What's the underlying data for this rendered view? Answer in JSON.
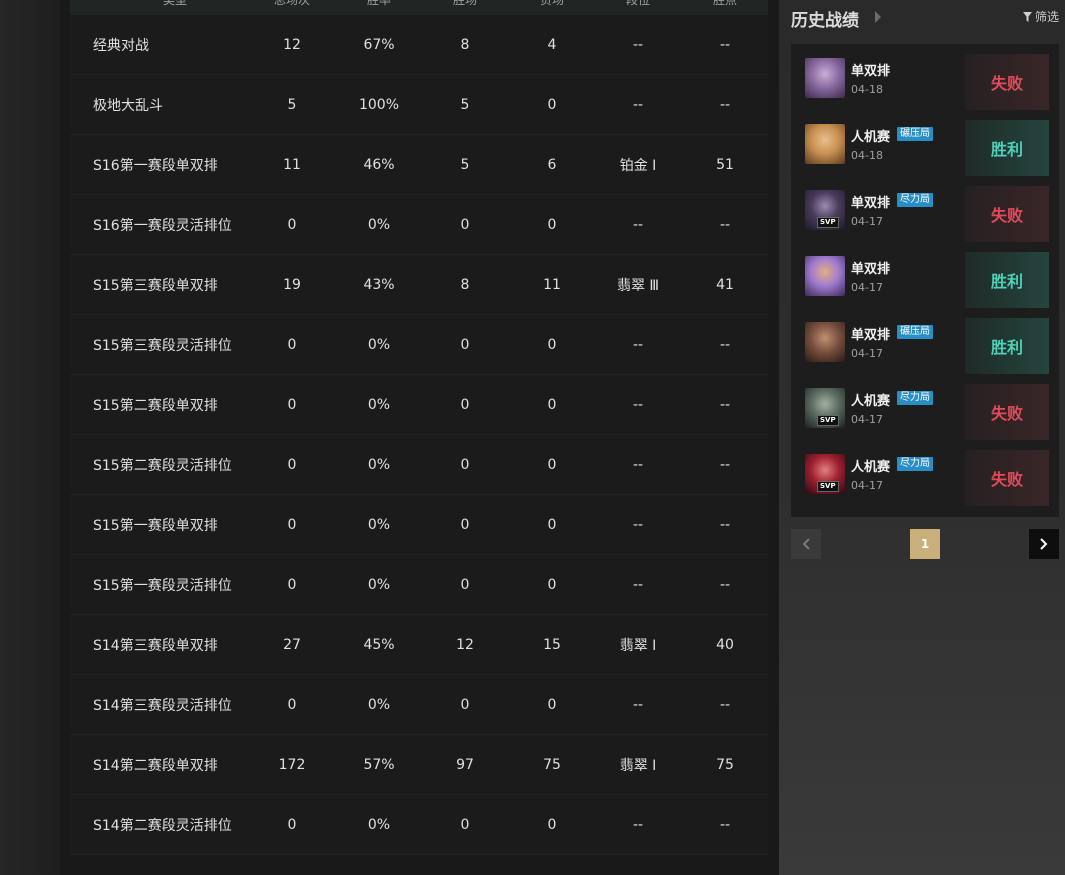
{
  "stats": {
    "headers": [
      "类型",
      "总场次",
      "胜率",
      "胜场",
      "负场",
      "段位",
      "胜点"
    ],
    "rows": [
      {
        "mode": "经典对战",
        "total": "12",
        "winrate": "67%",
        "wins": "8",
        "losses": "4",
        "rank": "--",
        "lp": "--"
      },
      {
        "mode": "极地大乱斗",
        "total": "5",
        "winrate": "100%",
        "wins": "5",
        "losses": "0",
        "rank": "--",
        "lp": "--"
      },
      {
        "mode": "S16第一赛段单双排",
        "total": "11",
        "winrate": "46%",
        "wins": "5",
        "losses": "6",
        "rank": "铂金 Ⅰ",
        "lp": "51"
      },
      {
        "mode": "S16第一赛段灵活排位",
        "total": "0",
        "winrate": "0%",
        "wins": "0",
        "losses": "0",
        "rank": "--",
        "lp": "--"
      },
      {
        "mode": "S15第三赛段单双排",
        "total": "19",
        "winrate": "43%",
        "wins": "8",
        "losses": "11",
        "rank": "翡翠 Ⅲ",
        "lp": "41"
      },
      {
        "mode": "S15第三赛段灵活排位",
        "total": "0",
        "winrate": "0%",
        "wins": "0",
        "losses": "0",
        "rank": "--",
        "lp": "--"
      },
      {
        "mode": "S15第二赛段单双排",
        "total": "0",
        "winrate": "0%",
        "wins": "0",
        "losses": "0",
        "rank": "--",
        "lp": "--"
      },
      {
        "mode": "S15第二赛段灵活排位",
        "total": "0",
        "winrate": "0%",
        "wins": "0",
        "losses": "0",
        "rank": "--",
        "lp": "--"
      },
      {
        "mode": "S15第一赛段单双排",
        "total": "0",
        "winrate": "0%",
        "wins": "0",
        "losses": "0",
        "rank": "--",
        "lp": "--"
      },
      {
        "mode": "S15第一赛段灵活排位",
        "total": "0",
        "winrate": "0%",
        "wins": "0",
        "losses": "0",
        "rank": "--",
        "lp": "--"
      },
      {
        "mode": "S14第三赛段单双排",
        "total": "27",
        "winrate": "45%",
        "wins": "12",
        "losses": "15",
        "rank": "翡翠 Ⅰ",
        "lp": "40"
      },
      {
        "mode": "S14第三赛段灵活排位",
        "total": "0",
        "winrate": "0%",
        "wins": "0",
        "losses": "0",
        "rank": "--",
        "lp": "--"
      },
      {
        "mode": "S14第二赛段单双排",
        "total": "172",
        "winrate": "57%",
        "wins": "97",
        "losses": "75",
        "rank": "翡翠 Ⅰ",
        "lp": "75"
      },
      {
        "mode": "S14第二赛段灵活排位",
        "total": "0",
        "winrate": "0%",
        "wins": "0",
        "losses": "0",
        "rank": "--",
        "lp": "--"
      }
    ]
  },
  "history": {
    "title": "历史战绩",
    "filter_label": "筛选",
    "filter_icon": "funnel-icon",
    "matches": [
      {
        "mode": "单双排",
        "tag": "",
        "date": "04-18",
        "result": "失败",
        "win": false,
        "svp": "",
        "avatar_colors": [
          "#3a2a4a",
          "#8a6aa0",
          "#c6b0d8"
        ]
      },
      {
        "mode": "人机赛",
        "tag": "碾压局",
        "date": "04-18",
        "result": "胜利",
        "win": true,
        "svp": "",
        "avatar_colors": [
          "#5a3a20",
          "#c89050",
          "#e8c090"
        ]
      },
      {
        "mode": "单双排",
        "tag": "尽力局",
        "date": "04-17",
        "result": "失败",
        "win": false,
        "svp": "SVP",
        "avatar_colors": [
          "#1a1a2a",
          "#4a3a5a",
          "#9a8ab0"
        ]
      },
      {
        "mode": "单双排",
        "tag": "",
        "date": "04-17",
        "result": "胜利",
        "win": true,
        "svp": "",
        "avatar_colors": [
          "#3a2a5a",
          "#a07ad0",
          "#e0b080"
        ]
      },
      {
        "mode": "单双排",
        "tag": "碾压局",
        "date": "04-17",
        "result": "胜利",
        "win": true,
        "svp": "",
        "avatar_colors": [
          "#2a1a14",
          "#7a5040",
          "#c09070"
        ]
      },
      {
        "mode": "人机赛",
        "tag": "尽力局",
        "date": "04-17",
        "result": "失败",
        "win": false,
        "svp": "SVP",
        "avatar_colors": [
          "#1a2020",
          "#5a6a60",
          "#a0b0a0"
        ]
      },
      {
        "mode": "人机赛",
        "tag": "尽力局",
        "date": "04-17",
        "result": "失败",
        "win": false,
        "svp": "SVP",
        "avatar_colors": [
          "#2a0a10",
          "#a02030",
          "#e08080"
        ]
      }
    ],
    "pager": {
      "prev_icon": "chevron-left-icon",
      "current_page": "1",
      "next_icon": "chevron-right-icon"
    }
  }
}
